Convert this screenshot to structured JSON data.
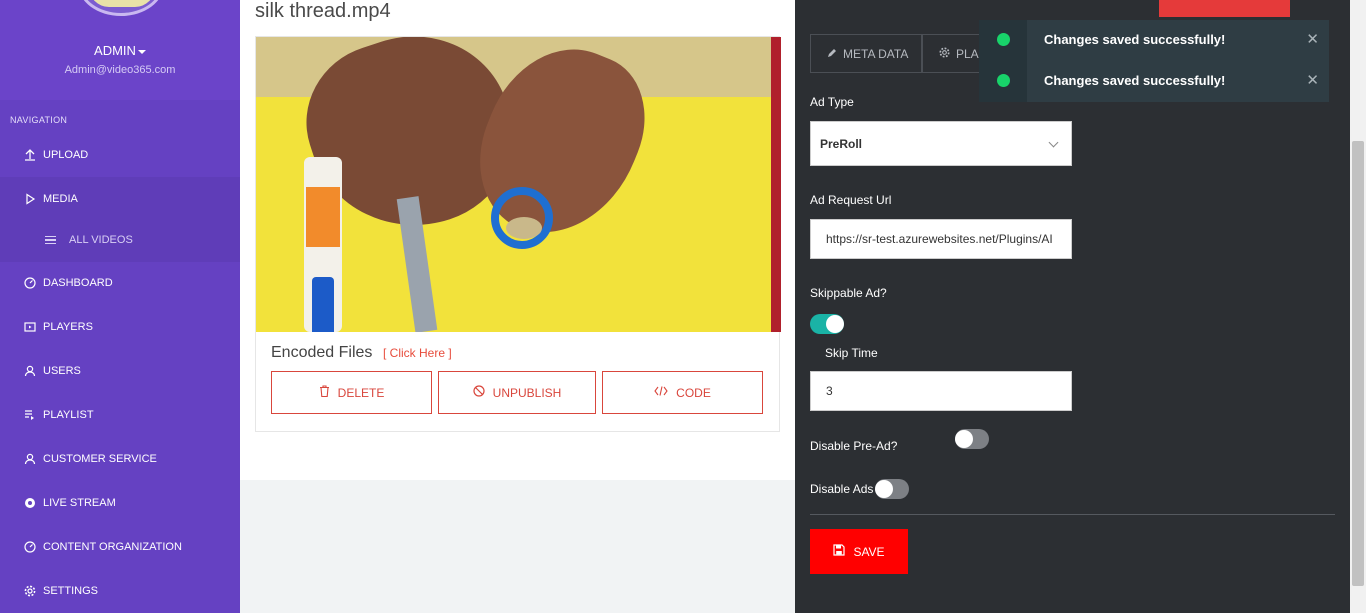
{
  "sidebar": {
    "user_name": "ADMIN",
    "user_email": "Admin@video365.com",
    "nav_heading": "NAVIGATION",
    "items": [
      {
        "label": "UPLOAD",
        "icon": "upload-icon"
      },
      {
        "label": "MEDIA",
        "icon": "play-icon"
      },
      {
        "label": "ALL VIDEOS",
        "icon": "list-icon"
      },
      {
        "label": "DASHBOARD",
        "icon": "gauge-icon"
      },
      {
        "label": "PLAYERS",
        "icon": "player-icon"
      },
      {
        "label": "USERS",
        "icon": "user-icon"
      },
      {
        "label": "PLAYLIST",
        "icon": "playlist-icon"
      },
      {
        "label": "CUSTOMER SERVICE",
        "icon": "user-icon"
      },
      {
        "label": "LIVE STREAM",
        "icon": "live-icon"
      },
      {
        "label": "CONTENT ORGANIZATION",
        "icon": "gauge-icon"
      },
      {
        "label": "SETTINGS",
        "icon": "gear-icon"
      }
    ]
  },
  "main": {
    "video_title": "silk thread.mp4",
    "encoded_files_label": "Encoded Files",
    "click_here_label": "[ Click Here ]",
    "buttons": {
      "delete": "DELETE",
      "unpublish": "UNPUBLISH",
      "code": "CODE"
    }
  },
  "panel": {
    "tabs": [
      {
        "label": "META DATA",
        "icon": "pencil-icon"
      },
      {
        "label": "PLA",
        "icon": "gear-icon"
      }
    ],
    "ad_type_label": "Ad Type",
    "ad_type_value": "PreRoll",
    "ad_request_url_label": "Ad Request Url",
    "ad_request_url_value": "https://sr-test.azurewebsites.net/Plugins/AI",
    "skippable_label": "Skippable Ad?",
    "skippable_on": true,
    "skip_time_label": "Skip Time",
    "skip_time_value": "3",
    "disable_pre_ad_label": "Disable Pre-Ad?",
    "disable_pre_ad_on": false,
    "disable_ads_label": "Disable Ads",
    "disable_ads_on": false,
    "save_label": "SAVE"
  },
  "toasts": [
    {
      "message": "Changes saved successfully!",
      "status_color": "#18d36a"
    },
    {
      "message": "Changes saved successfully!",
      "status_color": "#18d36a"
    }
  ],
  "colors": {
    "sidebar": "#6b44c9",
    "accent_red": "#ff0000",
    "toggle_on": "#1ab3a6",
    "panel_bg": "#2c2f33"
  }
}
